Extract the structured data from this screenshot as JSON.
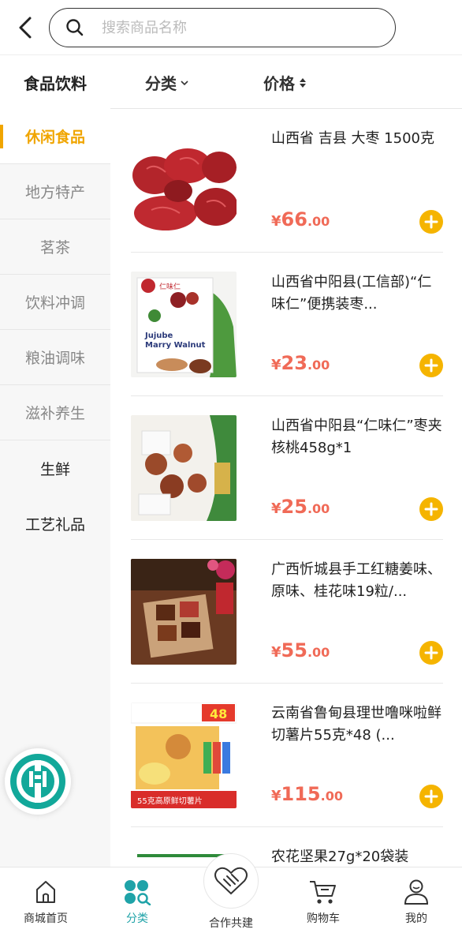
{
  "search": {
    "placeholder": "搜索商品名称"
  },
  "sidebar": {
    "header": "食品饮料",
    "items": [
      {
        "label": "休闲食品",
        "active": true
      },
      {
        "label": "地方特产"
      },
      {
        "label": "茗茶"
      },
      {
        "label": "饮料冲调"
      },
      {
        "label": "粮油调味"
      },
      {
        "label": "滋补养生"
      },
      {
        "label": "生鲜"
      },
      {
        "label": "工艺礼品"
      }
    ]
  },
  "filters": {
    "category": "分类",
    "price": "价格"
  },
  "products": [
    {
      "name": "山西省 吉县 大枣 1500克",
      "currency": "¥",
      "price_int": "66",
      "price_dec": ".00"
    },
    {
      "name": "山西省中阳县(工信部)“仁味仁”便携装枣...",
      "currency": "¥",
      "price_int": "23",
      "price_dec": ".00"
    },
    {
      "name": "山西省中阳县“仁味仁”枣夹核桃458g*1",
      "currency": "¥",
      "price_int": "25",
      "price_dec": ".00"
    },
    {
      "name": "广西忻城县手工红糖姜味、原味、桂花味19粒/...",
      "currency": "¥",
      "price_int": "55",
      "price_dec": ".00"
    },
    {
      "name": "云南省鲁甸县理世噜咪啦鲜切薯片55克*48 (...",
      "currency": "¥",
      "price_int": "115",
      "price_dec": ".00"
    },
    {
      "name": "农花坚果27g*20袋装",
      "currency": "",
      "price_int": "",
      "price_dec": ""
    }
  ],
  "image_text": {
    "p2_pack": "Jujube Marry Walnut",
    "p5_badge": "48",
    "p5_banner": "55克高原鲜切薯片"
  },
  "nav": [
    {
      "label": "商城首页",
      "icon": "home-icon"
    },
    {
      "label": "分类",
      "icon": "category-icon",
      "active": true
    },
    {
      "label": "合作共建",
      "icon": "handshake-icon"
    },
    {
      "label": "购物车",
      "icon": "cart-icon"
    },
    {
      "label": "我的",
      "icon": "profile-icon"
    }
  ],
  "colors": {
    "accent": "#f0a500",
    "price": "#f06a57",
    "add_button": "#f5b400",
    "nav_active": "#1fa3a8",
    "logo": "#12a89a"
  }
}
